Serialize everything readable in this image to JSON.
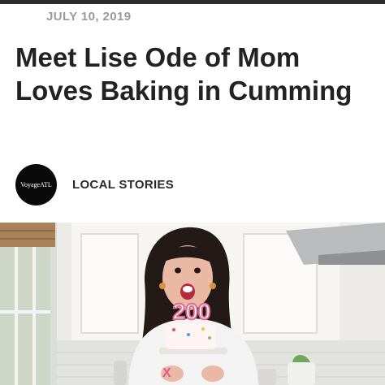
{
  "article": {
    "date": "JULY 10, 2019",
    "title": "Meet Lise Ode of Mom Loves Baking in Cumming",
    "author_avatar_text": "VoyageATL",
    "category": "LOCAL STORIES"
  },
  "hero": {
    "cake_candle_text": "200",
    "shirt_text": "X"
  },
  "colors": {
    "title": "#222222",
    "date": "#9a9a9a",
    "avatar_bg": "#0a0a0a"
  }
}
